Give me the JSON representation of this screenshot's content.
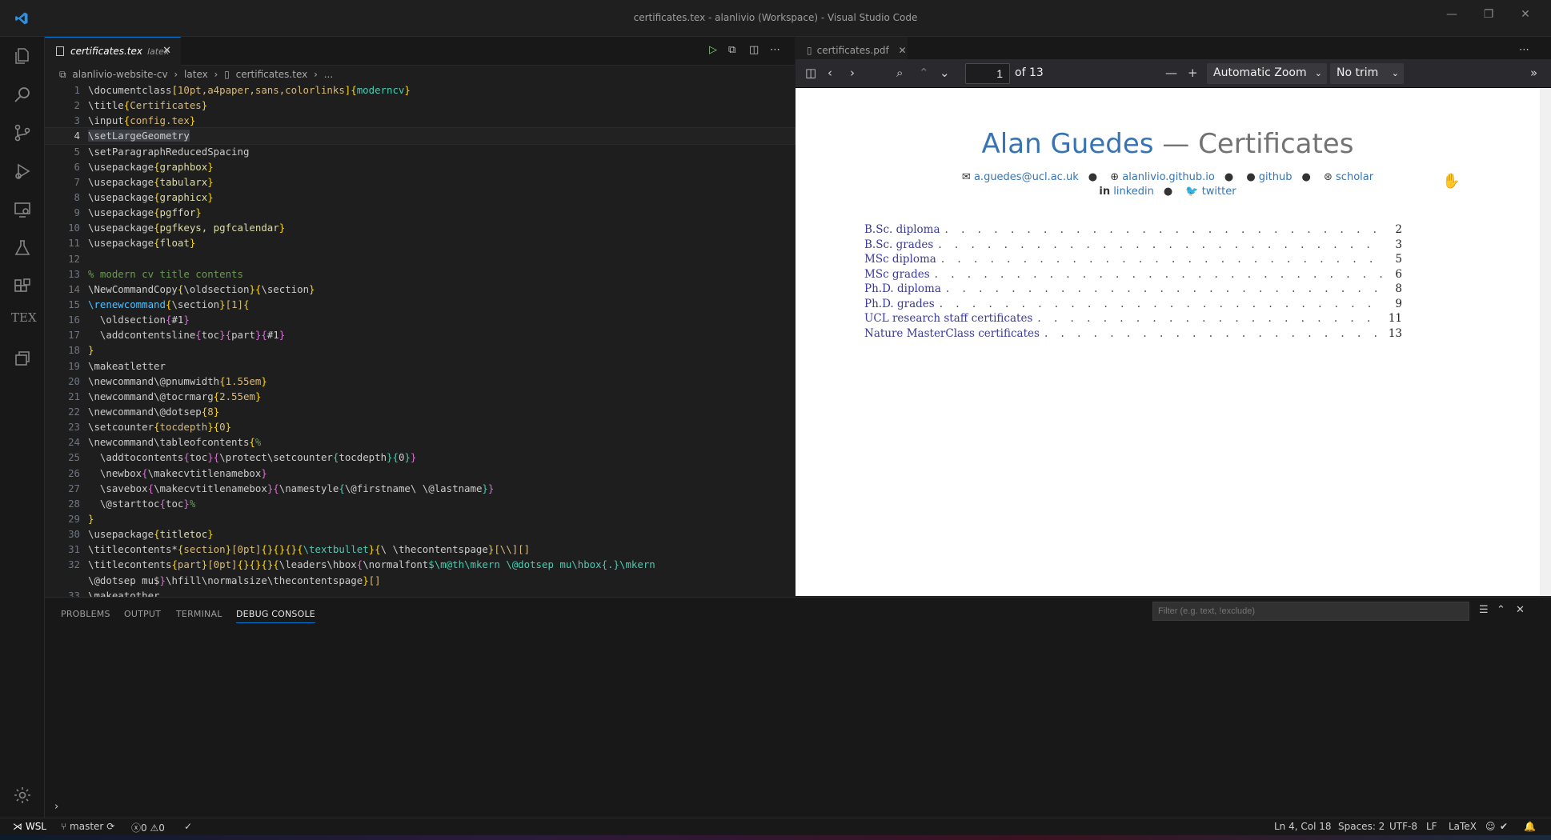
{
  "window": {
    "title": "certificates.tex - alanlivio (Workspace) - Visual Studio Code"
  },
  "activity": {
    "tex_label": "TEX"
  },
  "left_editor": {
    "tab": {
      "name": "certificates.tex",
      "lang": "latex"
    },
    "breadcrumb": [
      "alanlivio-website-cv",
      "latex",
      "certificates.tex",
      "..."
    ],
    "lines": [
      {
        "n": "1",
        "html": "\\documentclass<span class='br'>[</span><span class='arg'>10pt,a4paper,sans,colorlinks</span><span class='br'>]{</span><span class='blu'>moderncv</span><span class='br'>}</span>"
      },
      {
        "n": "2",
        "html": "\\title<span class='br'>{</span><span class='arg'>Certificates</span><span class='br'>}</span>"
      },
      {
        "n": "3",
        "html": "\\input<span class='br'>{</span><span class='arg'>config.tex</span><span class='br'>}</span>"
      },
      {
        "n": "4",
        "html": "<span class='hl'>\\setLargeGeometry</span>",
        "cur": true
      },
      {
        "n": "5",
        "html": "\\setParagraphReducedSpacing"
      },
      {
        "n": "6",
        "html": "\\usepackage<span class='br'>{</span><span class='pk'>graphbox</span><span class='br'>}</span>"
      },
      {
        "n": "7",
        "html": "\\usepackage<span class='br'>{</span><span class='pk'>tabularx</span><span class='br'>}</span>"
      },
      {
        "n": "8",
        "html": "\\usepackage<span class='br'>{</span><span class='pk'>graphicx</span><span class='br'>}</span>"
      },
      {
        "n": "9",
        "html": "\\usepackage<span class='br'>{</span><span class='pk'>pgffor</span><span class='br'>}</span>"
      },
      {
        "n": "10",
        "html": "\\usepackage<span class='br'>{</span><span class='pk'>pgfkeys, pgfcalendar</span><span class='br'>}</span>"
      },
      {
        "n": "11",
        "html": "\\usepackage<span class='br'>{</span><span class='pk'>float</span><span class='br'>}</span>"
      },
      {
        "n": "12",
        "html": ""
      },
      {
        "n": "13",
        "html": "<span class='cmt'>% modern cv title contents</span>"
      },
      {
        "n": "14",
        "html": "\\NewCommandCopy<span class='br'>{</span>\\oldsection<span class='br'>}{</span>\\section<span class='br'>}</span>"
      },
      {
        "n": "15",
        "html": "<span class='dim'>\\renewcommand</span><span class='br'>{</span>\\section<span class='br'>}</span><span class='arg'>[1]</span><span class='br'>{</span>"
      },
      {
        "n": "16",
        "html": "  \\oldsection<span class='pink'>{</span>#1<span class='pink'>}</span>"
      },
      {
        "n": "17",
        "html": "  \\addcontentsline<span class='pink'>{</span>toc<span class='pink'>}{</span>part<span class='pink'>}{</span>#1<span class='pink'>}</span>"
      },
      {
        "n": "18",
        "html": "<span class='br'>}</span>"
      },
      {
        "n": "19",
        "html": "\\makeatletter"
      },
      {
        "n": "20",
        "html": "\\newcommand\\@pnumwidth<span class='br'>{</span><span class='arg'>1.55em</span><span class='br'>}</span>"
      },
      {
        "n": "21",
        "html": "\\newcommand\\@tocrmarg<span class='br'>{</span><span class='arg'>2.55em</span><span class='br'>}</span>"
      },
      {
        "n": "22",
        "html": "\\newcommand\\@dotsep<span class='br'>{</span><span class='arg'>8</span><span class='br'>}</span>"
      },
      {
        "n": "23",
        "html": "\\setcounter<span class='br'>{</span><span class='arg'>tocdepth</span><span class='br'>}{</span><span class='arg'>0</span><span class='br'>}</span>"
      },
      {
        "n": "24",
        "html": "\\newcommand\\tableofcontents<span class='br'>{</span><span class='cmt'>%</span>"
      },
      {
        "n": "25",
        "html": "  \\addtocontents<span class='pink'>{</span>toc<span class='pink'>}{</span>\\protect\\setcounter<span class='blu'>{</span>tocdepth<span class='blu'>}{</span>0<span class='blu'>}</span><span class='pink'>}</span>"
      },
      {
        "n": "26",
        "html": "  \\newbox<span class='pink'>{</span>\\makecvtitlenamebox<span class='pink'>}</span>"
      },
      {
        "n": "27",
        "html": "  \\savebox<span class='pink'>{</span>\\makecvtitlenamebox<span class='pink'>}{</span>\\namestyle<span class='blu'>{</span>\\@firstname\\ \\@lastname<span class='blu'>}</span><span class='pink'>}</span>"
      },
      {
        "n": "28",
        "html": "  \\@starttoc<span class='pink'>{</span>toc<span class='pink'>}</span><span class='cmt'>%</span>"
      },
      {
        "n": "29",
        "html": "<span class='br'>}</span>"
      },
      {
        "n": "30",
        "html": "\\usepackage<span class='br'>{</span><span class='pk'>titletoc</span><span class='br'>}</span>"
      },
      {
        "n": "31",
        "html": "\\titlecontents*<span class='br'>{</span><span class='arg'>section</span><span class='br'>}</span><span class='arg'>[0pt]</span><span class='br'>{}{}{}{</span><span class='blu'>\\textbullet</span><span class='br'>}{</span>\\ \\thecontentspage<span class='br'>}</span><span class='arg'>[\\\\][]</span>"
      },
      {
        "n": "32",
        "html": "\\titlecontents<span class='br'>{</span><span class='arg'>part</span><span class='br'>}</span><span class='arg'>[0pt]</span><span class='br'>{}{}{}{</span>\\leaders\\hbox<span class='pink'>{</span>\\normalfont<span class='blu'>$\\m@th\\mkern \\@dotsep mu\\hbox{.}\\mkern</span>"
      },
      {
        "n": "",
        "html": "\\@dotsep mu$<span class='pink'>}</span>\\hfill\\normalsize\\thecontentspage<span class='br'>}</span><span class='arg'>[]</span>"
      },
      {
        "n": "33",
        "html": "\\makeatother"
      }
    ]
  },
  "right_editor": {
    "tab": {
      "name": "certificates.pdf"
    },
    "toolbar": {
      "page_value": "1",
      "page_count": "of 13",
      "zoom": "Automatic Zoom",
      "trim": "No trim"
    },
    "pdf": {
      "first_name": "Alan Guedes",
      "separator": " — ",
      "last_name": "Certificates",
      "contact_row1": [
        "a.guedes@ucl.ac.uk",
        "alanlivio.github.io",
        "github",
        "scholar"
      ],
      "contact_row2": [
        "linkedin",
        "twitter"
      ],
      "toc": [
        {
          "title": "B.Sc. diploma",
          "page": "2"
        },
        {
          "title": "B.Sc. grades",
          "page": "3"
        },
        {
          "title": "MSc diploma",
          "page": "5"
        },
        {
          "title": "MSc grades",
          "page": "6"
        },
        {
          "title": "Ph.D. diploma",
          "page": "8"
        },
        {
          "title": "Ph.D. grades",
          "page": "9"
        },
        {
          "title": "UCL research staff certificates",
          "page": "11"
        },
        {
          "title": "Nature MasterClass certificates",
          "page": "13"
        }
      ]
    }
  },
  "panel": {
    "tabs": [
      "PROBLEMS",
      "OUTPUT",
      "TERMINAL",
      "DEBUG CONSOLE"
    ],
    "active_tab": 3,
    "filter_placeholder": "Filter (e.g. text, !exclude)"
  },
  "status": {
    "remote": "WSL",
    "branch": "master",
    "errors": "0",
    "warnings": "0",
    "position": "Ln 4, Col 18",
    "spaces": "Spaces: 2",
    "encoding": "UTF-8",
    "eol": "LF",
    "language": "LaTeX"
  },
  "colors": {
    "accent": "#0078d4",
    "pdf_blue": "#3873b3"
  }
}
